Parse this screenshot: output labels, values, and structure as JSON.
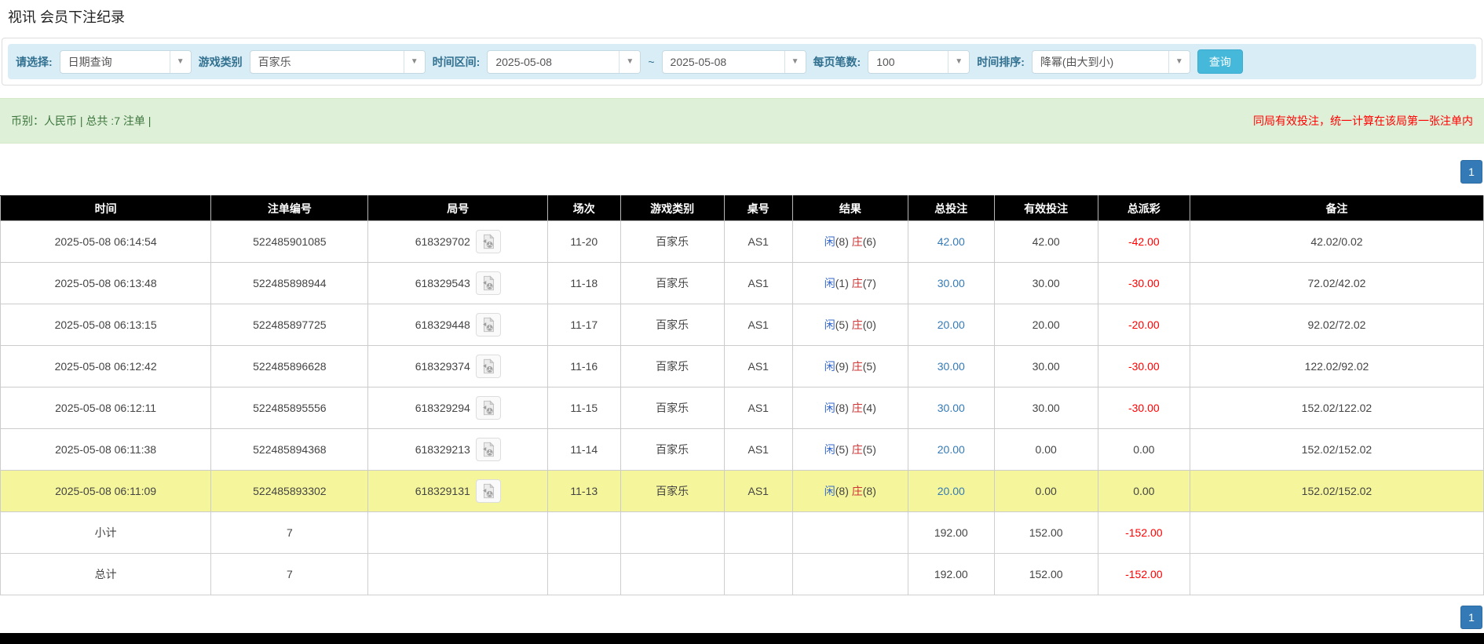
{
  "page": {
    "title": "视讯 会员下注纪录"
  },
  "filters": {
    "query_type_label": "请选择:",
    "query_type_value": "日期查询",
    "game_type_label": "游戏类别",
    "game_type_value": "百家乐",
    "time_range_label": "时间区间:",
    "date_from": "2025-05-08",
    "tilde": "~",
    "date_to": "2025-05-08",
    "per_page_label": "每页笔数:",
    "per_page_value": "100",
    "sort_label": "时间排序:",
    "sort_value": "降幂(由大到小)",
    "search_button": "查询"
  },
  "summary": {
    "left": "币别：人民币 | 总共 :7 注单 |",
    "right": "同局有效投注，统一计算在该局第一张注单内"
  },
  "pagination": {
    "page": "1"
  },
  "icons": {
    "dropdown_arrow": "chevron-down",
    "round_video": "film-reel-document"
  },
  "colors": {
    "accent_blue": "#337ab7",
    "search_button_teal": "#46b8da",
    "filter_bar_blue": "#d9edf7",
    "summary_green_bg": "#dff0d8",
    "summary_green_text": "#3c763d",
    "notice_red": "#ff0000",
    "player_blue": "#3366cc",
    "banker_red": "#cc3333",
    "highlight_yellow": "#f5f59b",
    "totals_gray": "#9b9b9b",
    "header_black": "#000000"
  },
  "table": {
    "headers": [
      "时间",
      "注单编号",
      "局号",
      "场次",
      "游戏类别",
      "桌号",
      "结果",
      "总投注",
      "有效投注",
      "总派彩",
      "备注"
    ],
    "rows": [
      {
        "time": "2025-05-08 06:14:54",
        "bet_id": "522485901085",
        "round_id": "618329702",
        "session": "11-20",
        "game": "百家乐",
        "table_no": "AS1",
        "p_label": "闲",
        "p_score": "(8)",
        "b_label": "庄",
        "b_score": "(6)",
        "total_bet": "42.00",
        "valid_bet": "42.00",
        "payout": "-42.00",
        "remark": "42.02/0.02",
        "highlight": false
      },
      {
        "time": "2025-05-08 06:13:48",
        "bet_id": "522485898944",
        "round_id": "618329543",
        "session": "11-18",
        "game": "百家乐",
        "table_no": "AS1",
        "p_label": "闲",
        "p_score": "(1)",
        "b_label": "庄",
        "b_score": "(7)",
        "total_bet": "30.00",
        "valid_bet": "30.00",
        "payout": "-30.00",
        "remark": "72.02/42.02",
        "highlight": false
      },
      {
        "time": "2025-05-08 06:13:15",
        "bet_id": "522485897725",
        "round_id": "618329448",
        "session": "11-17",
        "game": "百家乐",
        "table_no": "AS1",
        "p_label": "闲",
        "p_score": "(5)",
        "b_label": "庄",
        "b_score": "(0)",
        "total_bet": "20.00",
        "valid_bet": "20.00",
        "payout": "-20.00",
        "remark": "92.02/72.02",
        "highlight": false
      },
      {
        "time": "2025-05-08 06:12:42",
        "bet_id": "522485896628",
        "round_id": "618329374",
        "session": "11-16",
        "game": "百家乐",
        "table_no": "AS1",
        "p_label": "闲",
        "p_score": "(9)",
        "b_label": "庄",
        "b_score": "(5)",
        "total_bet": "30.00",
        "valid_bet": "30.00",
        "payout": "-30.00",
        "remark": "122.02/92.02",
        "highlight": false
      },
      {
        "time": "2025-05-08 06:12:11",
        "bet_id": "522485895556",
        "round_id": "618329294",
        "session": "11-15",
        "game": "百家乐",
        "table_no": "AS1",
        "p_label": "闲",
        "p_score": "(8)",
        "b_label": "庄",
        "b_score": "(4)",
        "total_bet": "30.00",
        "valid_bet": "30.00",
        "payout": "-30.00",
        "remark": "152.02/122.02",
        "highlight": false
      },
      {
        "time": "2025-05-08 06:11:38",
        "bet_id": "522485894368",
        "round_id": "618329213",
        "session": "11-14",
        "game": "百家乐",
        "table_no": "AS1",
        "p_label": "闲",
        "p_score": "(5)",
        "b_label": "庄",
        "b_score": "(5)",
        "total_bet": "20.00",
        "valid_bet": "0.00",
        "payout": "0.00",
        "remark": "152.02/152.02",
        "highlight": false
      },
      {
        "time": "2025-05-08 06:11:09",
        "bet_id": "522485893302",
        "round_id": "618329131",
        "session": "11-13",
        "game": "百家乐",
        "table_no": "AS1",
        "p_label": "闲",
        "p_score": "(8)",
        "b_label": "庄",
        "b_score": "(8)",
        "total_bet": "20.00",
        "valid_bet": "0.00",
        "payout": "0.00",
        "remark": "152.02/152.02",
        "highlight": true
      }
    ],
    "footer": [
      {
        "label": "小计",
        "count": "7",
        "total_bet": "192.00",
        "valid_bet": "152.00",
        "payout": "-152.00"
      },
      {
        "label": "总计",
        "count": "7",
        "total_bet": "192.00",
        "valid_bet": "152.00",
        "payout": "-152.00"
      }
    ]
  }
}
